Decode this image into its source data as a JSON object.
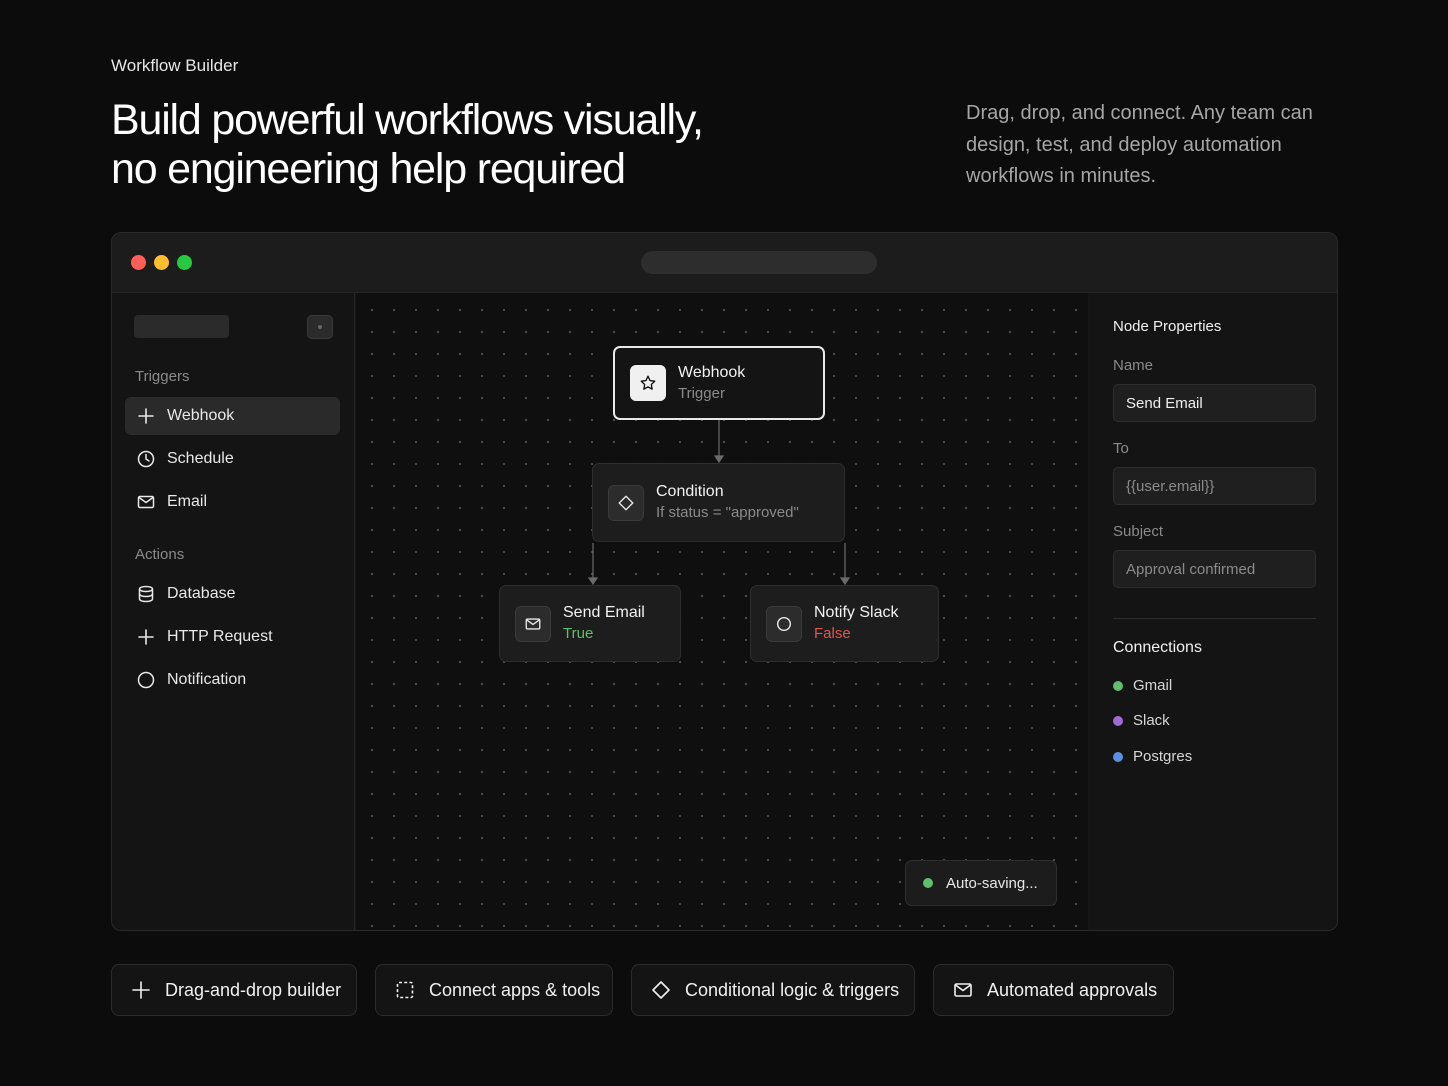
{
  "hero": {
    "eyebrow": "Workflow Builder",
    "headline_line1": "Build powerful workflows visually,",
    "headline_line2": "no engineering help required",
    "description": "Drag, drop, and connect. Any team can design, test, and deploy automation workflows in minutes."
  },
  "sidebar": {
    "triggers_label": "Triggers",
    "triggers": [
      {
        "label": "Webhook",
        "icon": "plus-icon",
        "active": true
      },
      {
        "label": "Schedule",
        "icon": "clock-icon",
        "active": false
      },
      {
        "label": "Email",
        "icon": "mail-icon",
        "active": false
      }
    ],
    "actions_label": "Actions",
    "actions": [
      {
        "label": "Database",
        "icon": "database-icon"
      },
      {
        "label": "HTTP Request",
        "icon": "plus-icon"
      },
      {
        "label": "Notification",
        "icon": "circle-icon"
      }
    ]
  },
  "canvas": {
    "nodes": {
      "webhook": {
        "title": "Webhook",
        "subtitle": "Trigger",
        "icon": "star-icon"
      },
      "condition": {
        "title": "Condition",
        "subtitle": "If status = \"approved\"",
        "icon": "diamond-icon"
      },
      "send_email": {
        "title": "Send Email",
        "subtitle": "True",
        "icon": "mail-icon"
      },
      "notify_slack": {
        "title": "Notify Slack",
        "subtitle": "False",
        "icon": "circle-icon"
      }
    },
    "autosave": "Auto-saving..."
  },
  "properties": {
    "title": "Node Properties",
    "name_label": "Name",
    "name_value": "Send Email",
    "to_label": "To",
    "to_value": "{{user.email}}",
    "subject_label": "Subject",
    "subject_value": "Approval confirmed",
    "connections_title": "Connections",
    "connections": [
      {
        "label": "Gmail",
        "color": "#5fbf6d"
      },
      {
        "label": "Slack",
        "color": "#a06bd8"
      },
      {
        "label": "Postgres",
        "color": "#5b8fe0"
      }
    ]
  },
  "features": [
    {
      "label": "Drag-and-drop builder",
      "icon": "plus-icon"
    },
    {
      "label": "Connect apps & tools",
      "icon": "frame-icon"
    },
    {
      "label": "Conditional logic & triggers",
      "icon": "diamond-icon"
    },
    {
      "label": "Automated approvals",
      "icon": "mail-icon"
    }
  ],
  "colors": {
    "background": "#0c0c0c",
    "true": "#5fbf6d",
    "false": "#e0574f"
  }
}
